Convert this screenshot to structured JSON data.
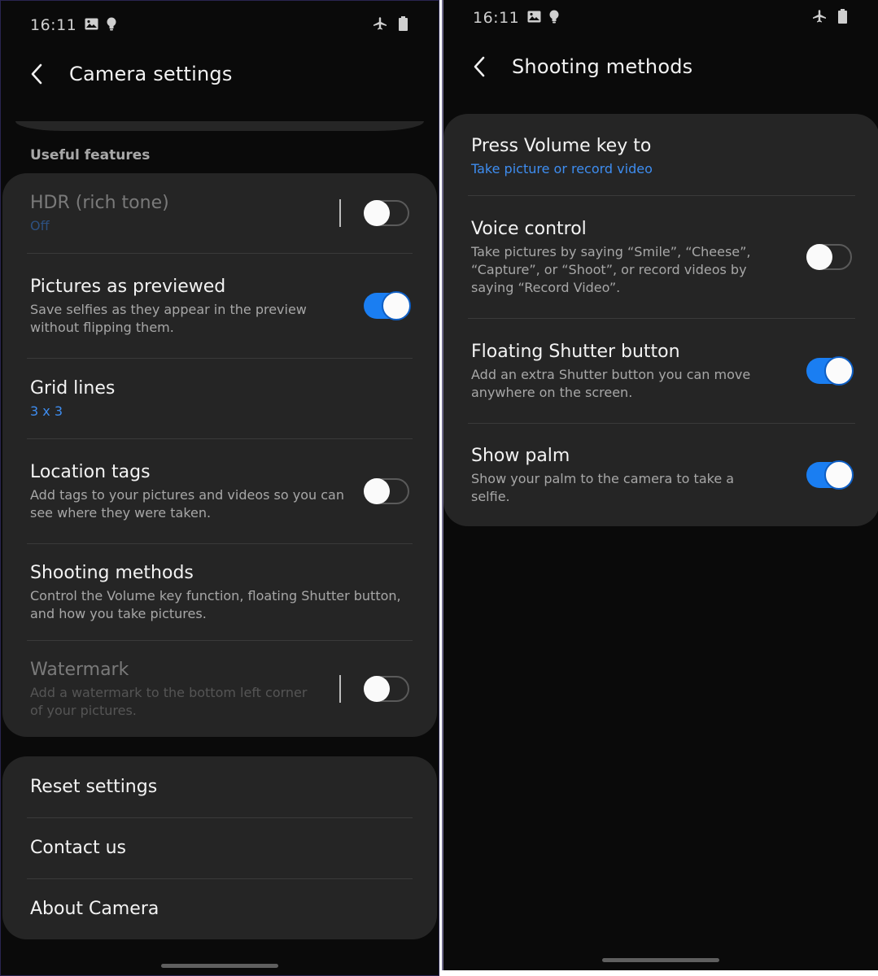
{
  "left_screen": {
    "status_bar": {
      "time": "16:11",
      "left_icons": [
        "gallery-icon",
        "bulb-icon"
      ],
      "right_icons": [
        "airplane-mode-icon",
        "battery-icon"
      ]
    },
    "app_bar": {
      "title": "Camera settings",
      "back_icon": "chevron-left-icon"
    },
    "section_header": "Useful features",
    "useful_features": [
      {
        "title": "HDR (rich tone)",
        "subtitle": "Off",
        "subtitle_style": "blue",
        "toggle": "off",
        "disabled": true,
        "separator": true
      },
      {
        "title": "Pictures as previewed",
        "subtitle": "Save selfies as they appear in the preview without flipping them.",
        "toggle": "on",
        "disabled": false
      },
      {
        "title": "Grid lines",
        "subtitle": "3 x 3",
        "subtitle_style": "blue",
        "disabled": false
      },
      {
        "title": "Location tags",
        "subtitle": "Add tags to your pictures and videos so you can see where they were taken.",
        "toggle": "off",
        "disabled": false
      },
      {
        "title": "Shooting methods",
        "subtitle": "Control the Volume key function, floating Shutter button, and how you take pictures.",
        "disabled": false
      },
      {
        "title": "Watermark",
        "subtitle": "Add a watermark to the bottom left corner of your pictures.",
        "toggle": "off",
        "disabled": true,
        "separator": true
      }
    ],
    "other_items": [
      {
        "title": "Reset settings"
      },
      {
        "title": "Contact us"
      },
      {
        "title": "About Camera"
      }
    ]
  },
  "right_screen": {
    "status_bar": {
      "time": "16:11",
      "left_icons": [
        "gallery-icon",
        "bulb-icon"
      ],
      "right_icons": [
        "airplane-mode-icon",
        "battery-icon"
      ]
    },
    "app_bar": {
      "title": "Shooting methods",
      "back_icon": "chevron-left-icon"
    },
    "items": [
      {
        "title": "Press Volume key to",
        "subtitle": "Take picture or record video",
        "subtitle_style": "blue"
      },
      {
        "title": "Voice control",
        "subtitle": "Take pictures by saying “Smile”, “Cheese”, “Capture”, or “Shoot”, or record videos by saying “Record Video”.",
        "toggle": "off"
      },
      {
        "title": "Floating Shutter button",
        "subtitle": "Add an extra Shutter button you can move anywhere on the screen.",
        "toggle": "on"
      },
      {
        "title": "Show palm",
        "subtitle": "Show your palm to the camera to take a selfie.",
        "toggle": "on"
      }
    ]
  },
  "colors": {
    "background": "#0a0a0a",
    "card": "#252525",
    "accent_blue": "#1a7ef2",
    "link_blue": "#3e8df0",
    "primary_text": "#f3f3f3",
    "secondary_text": "#a7a7a7"
  }
}
